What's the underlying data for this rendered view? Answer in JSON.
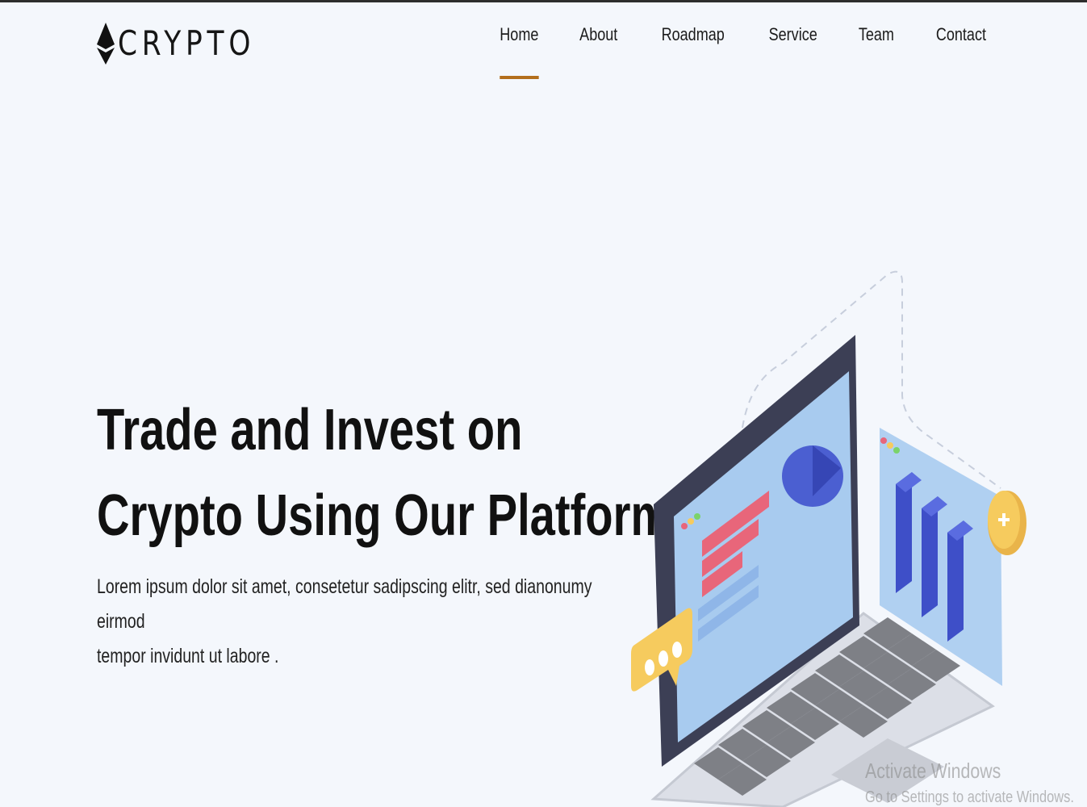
{
  "brand": {
    "logo_text": "CRYPTO"
  },
  "nav": {
    "items": [
      "Home",
      "About",
      "Roadmap",
      "Service",
      "Team",
      "Contact"
    ],
    "active": "Home"
  },
  "hero": {
    "title_line1": "Trade and Invest on",
    "title_line2": "Crypto Using Our Platform",
    "description_line1": "Lorem ipsum dolor sit amet, consetetur sadipscing elitr, sed dianonumy eirmod",
    "description_line2": "tempor invidunt ut labore ."
  },
  "os_watermark": {
    "title": "Activate Windows",
    "subtitle": "Go to Settings to activate Windows."
  },
  "colors": {
    "accent": "#b36e1c",
    "background": "#f4f7fc",
    "screen": "#a8cbef",
    "bars": "#3e4fc8",
    "chart_red": "#e8667a",
    "coin": "#f6cb5e"
  },
  "icons": [
    "ethereum-logo-icon",
    "chat-bubble-icon",
    "coin-icon"
  ]
}
